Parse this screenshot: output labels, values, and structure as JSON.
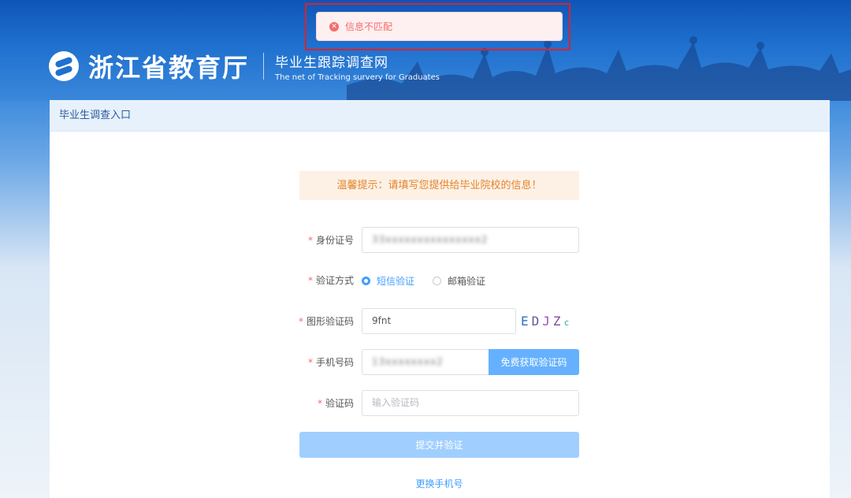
{
  "toast": {
    "message": "信息不匹配"
  },
  "header": {
    "org_name": "浙江省教育厅",
    "site_name": "毕业生跟踪调查网",
    "site_name_en": "The net of Tracking survery for Graduates"
  },
  "card": {
    "title": "毕业生调查入口",
    "tip": "温馨提示：请填写您提供给毕业院校的信息！"
  },
  "form": {
    "required_mark": "*",
    "id_label": "身份证号",
    "id_value": "33xxxxxxxxxxxxxxx2",
    "method_label": "验证方式",
    "method_options": [
      "短信验证",
      "邮箱验证"
    ],
    "captcha_label": "图形验证码",
    "captcha_value": "9fnt",
    "captcha_chars": [
      "E",
      "D",
      "J",
      "Z",
      "c"
    ],
    "phone_label": "手机号码",
    "phone_value": "13xxxxxxxx2",
    "sms_button": "免费获取验证码",
    "code_label": "验证码",
    "code_placeholder": "输入验证码",
    "submit_button": "提交并验证",
    "change_phone": "更换手机号"
  },
  "colors": {
    "primary": "#409eff",
    "error": "#f56c6c",
    "warning": "#e6842c"
  }
}
